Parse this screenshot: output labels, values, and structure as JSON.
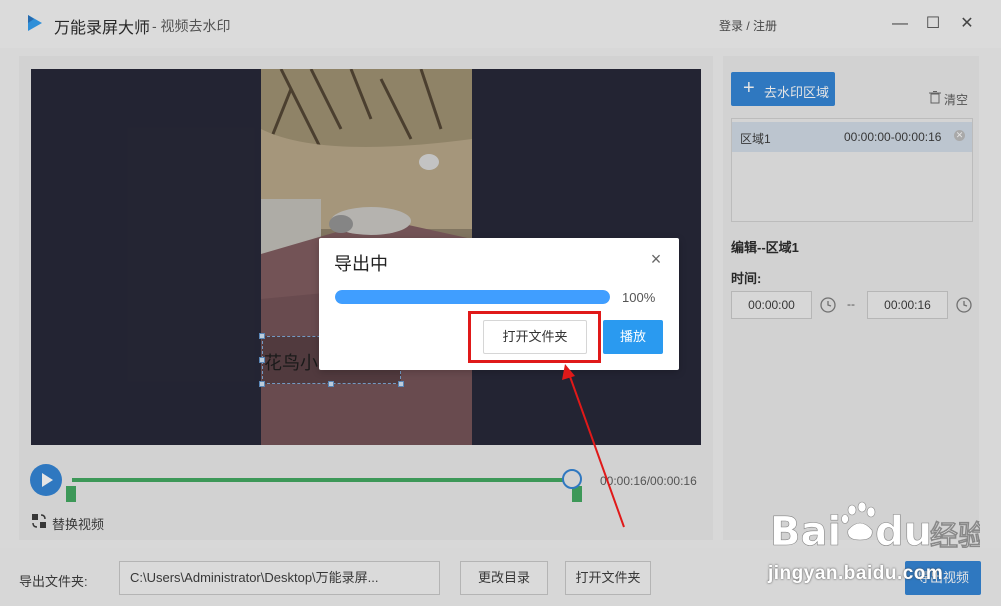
{
  "app": {
    "title": "万能录屏大师",
    "subtitle": "- 视频去水印",
    "login": "登录 / 注册",
    "window_controls": {
      "minimize": "—",
      "maximize": "☐",
      "close": "✕"
    }
  },
  "editor": {
    "watermark_text": "花鸟小",
    "time_readout": "00:00:16/00:00:16",
    "replace_video": "替换视频"
  },
  "sidebar": {
    "add_region": "去水印区域",
    "add_region_icon": "plus-icon",
    "clear": "清空",
    "regions": [
      {
        "name": "区域1",
        "time": "00:00:00-00:00:16"
      }
    ],
    "edit_title": "编辑--区域1",
    "time_label": "时间:",
    "start_time": "00:00:00",
    "end_time": "00:00:16",
    "separator": "--"
  },
  "footer": {
    "output_label": "导出文件夹:",
    "output_path": "C:\\Users\\Administrator\\Desktop\\万能录屏...",
    "change_dir": "更改目录",
    "open_folder": "打开文件夹",
    "export": "导出视频"
  },
  "dialog": {
    "title": "导出中",
    "close": "×",
    "progress": 100,
    "progress_text": "100%",
    "open_folder": "打开文件夹",
    "play": "播放"
  },
  "watermark": {
    "logo_text": "Bai",
    "logo_text2": "du",
    "logo_cn": "经验",
    "url": "jingyan.baidu.com"
  },
  "colors": {
    "accent": "#2a7fd4",
    "progress": "#409eff",
    "highlight": "#e01919",
    "timeline": "#3aa55a"
  }
}
